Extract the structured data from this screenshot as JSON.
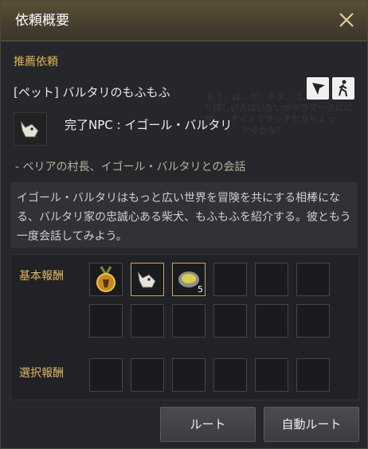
{
  "window": {
    "title": "依頼概要",
    "close_icon": "close-icon",
    "background": "#26272b",
    "accent": "#e3b44a"
  },
  "quest": {
    "section_label": "推薦依頼",
    "name": "[ペット] バルタリのもふもふ",
    "npc_label": "完了NPC : イゴール・バルタリ",
    "objective": "- ベリアの村長、イゴール・バルタリとの会話",
    "description": "イゴール・バルタリはもっと広い世界を冒険を共にする相棒になる、バルタリ家の忠誠心ある柴犬、もふもふを紹介する。彼ともう一度会話してみよう。",
    "bg_text_1": "もう、は、セ、キタ、ゴ、と、つ、",
    "bg_text_2": "り詳しい人はいないがドラマーさにに",
    "bg_text_3": "が……ナイトでオッチだたちょっ",
    "bg_text_4": "ヤるかな?"
  },
  "actions": {
    "navigate_icon": "navigate-arrow-icon",
    "auto_walk_icon": "walking-person-icon"
  },
  "rewards": {
    "basic_label": "基本報酬",
    "choice_label": "選択報酬",
    "basic_items": [
      {
        "name": "gold-medal-icon",
        "count": ""
      },
      {
        "name": "shiba-dog-icon",
        "count": ""
      },
      {
        "name": "food-bowl-icon",
        "count": "5"
      }
    ]
  },
  "buttons": {
    "route": "ルート",
    "auto_route": "自動ルート"
  }
}
